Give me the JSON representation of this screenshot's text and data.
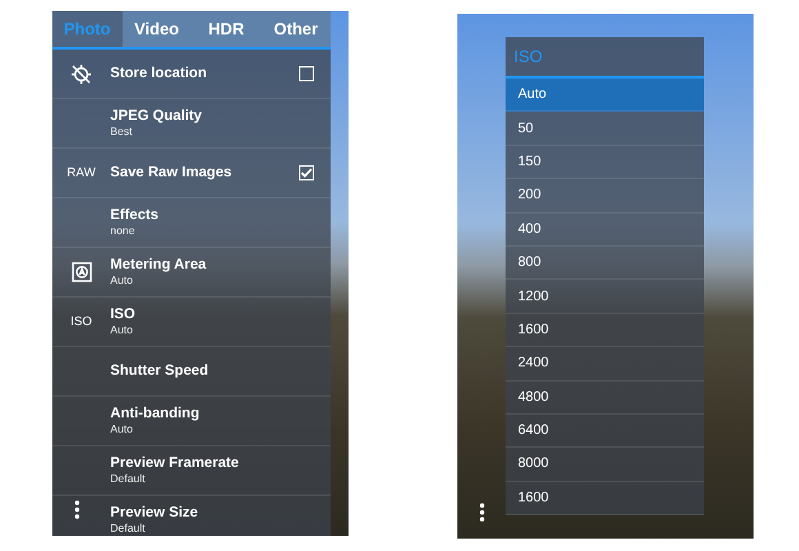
{
  "left_screen": {
    "tabs": [
      {
        "label": "Photo",
        "selected": true
      },
      {
        "label": "Video",
        "selected": false
      },
      {
        "label": "HDR",
        "selected": false
      },
      {
        "label": "Other",
        "selected": false
      }
    ],
    "settings": [
      {
        "kind": "checkbox",
        "title": "Store location",
        "checked": false
      },
      {
        "kind": "option",
        "title": "JPEG Quality",
        "value": "Best"
      },
      {
        "kind": "checkbox",
        "icon_text": "RAW",
        "title": "Save Raw Images",
        "checked": true
      },
      {
        "kind": "option",
        "title": "Effects",
        "value": "none"
      },
      {
        "kind": "option",
        "title": "Metering Area",
        "value": "Auto"
      },
      {
        "kind": "option",
        "icon_text": "ISO",
        "title": "ISO",
        "value": "Auto"
      },
      {
        "kind": "option",
        "title": "Shutter Speed"
      },
      {
        "kind": "option",
        "title": "Anti-banding",
        "value": "Auto"
      },
      {
        "kind": "option",
        "title": "Preview Framerate",
        "value": "Default"
      },
      {
        "kind": "option",
        "title": "Preview Size",
        "value": "Default"
      }
    ]
  },
  "right_screen": {
    "title": "ISO",
    "options": [
      {
        "label": "Auto",
        "selected": true
      },
      {
        "label": "50",
        "selected": false
      },
      {
        "label": "150",
        "selected": false
      },
      {
        "label": "200",
        "selected": false
      },
      {
        "label": "400",
        "selected": false
      },
      {
        "label": "800",
        "selected": false
      },
      {
        "label": "1200",
        "selected": false
      },
      {
        "label": "1600",
        "selected": false
      },
      {
        "label": "2400",
        "selected": false
      },
      {
        "label": "4800",
        "selected": false
      },
      {
        "label": "6400",
        "selected": false
      },
      {
        "label": "8000",
        "selected": false
      },
      {
        "label": "1600",
        "selected": false
      }
    ]
  }
}
